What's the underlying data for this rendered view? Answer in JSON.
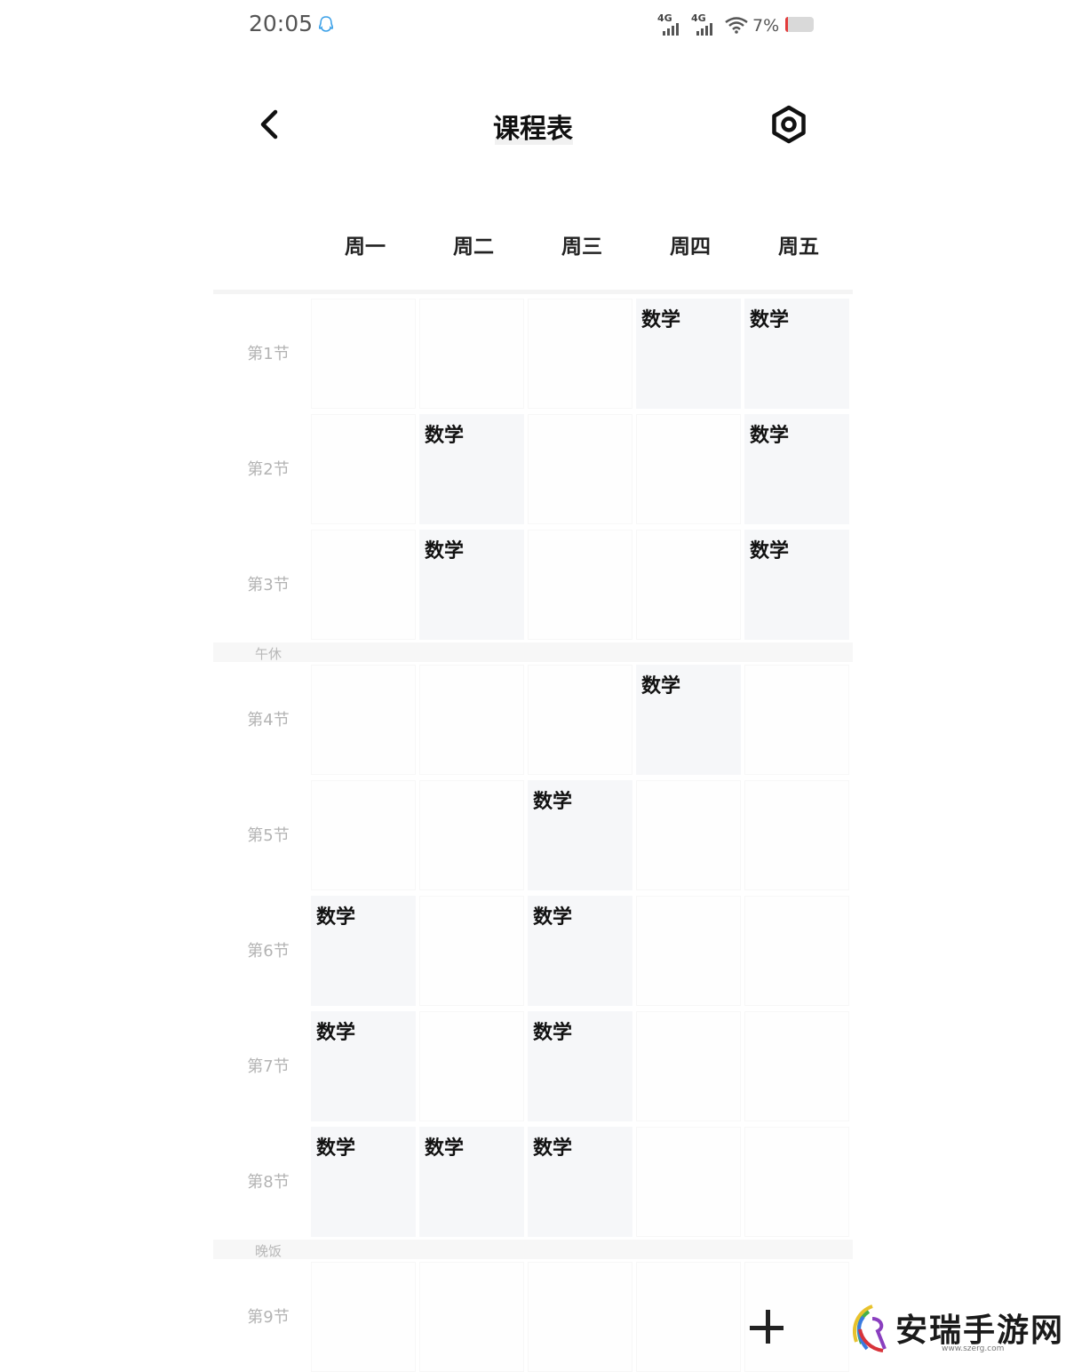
{
  "status_bar": {
    "time": "20:05",
    "signal_1": "4G",
    "signal_2": "4G",
    "battery": "7%"
  },
  "header": {
    "title": "课程表"
  },
  "days": [
    "周一",
    "周二",
    "周三",
    "周四",
    "周五"
  ],
  "periods": [
    "第1节",
    "第2节",
    "第3节",
    "第4节",
    "第5节",
    "第6节",
    "第7节",
    "第8节",
    "第9节"
  ],
  "breaks": {
    "lunch": "午休",
    "dinner": "晚饭"
  },
  "schedule": [
    [
      "",
      "",
      "",
      "数学",
      "数学"
    ],
    [
      "",
      "数学",
      "",
      "",
      "数学"
    ],
    [
      "",
      "数学",
      "",
      "",
      "数学"
    ],
    [
      "",
      "",
      "",
      "数学",
      ""
    ],
    [
      "",
      "",
      "数学",
      "",
      ""
    ],
    [
      "数学",
      "",
      "数学",
      "",
      ""
    ],
    [
      "数学",
      "",
      "数学",
      "",
      ""
    ],
    [
      "数学",
      "数学",
      "数学",
      "",
      ""
    ],
    [
      "",
      "",
      "",
      "",
      ""
    ]
  ],
  "watermark": {
    "name": "安瑞手游网",
    "url": "www.szerg.com"
  }
}
